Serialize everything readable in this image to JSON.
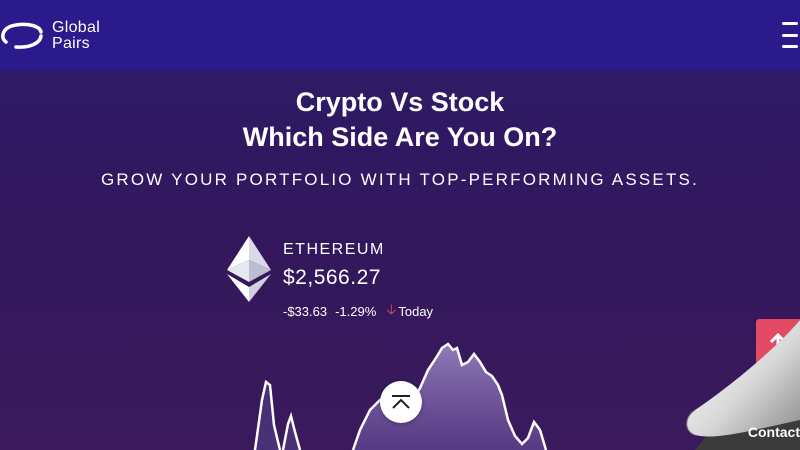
{
  "brand": {
    "line1": "Global",
    "line2": "Pairs",
    "logo_icon": "ring-logo-icon",
    "menu_icon": "hamburger-menu-icon"
  },
  "hero": {
    "headline_line1": "Crypto Vs Stock",
    "headline_line2": "Which Side Are You On?",
    "subheadline": "GROW YOUR PORTFOLIO WITH TOP-PERFORMING ASSETS."
  },
  "ticker": {
    "name": "ETHEREUM",
    "price": "$2,566.27",
    "change_abs": "-$33.63",
    "change_pct": "-1.29%",
    "direction_icon": "arrow-down-icon",
    "period": "Today",
    "coin_icon": "ethereum-icon"
  },
  "buttons": {
    "scroll_top_icon": "chevron-up-bar-icon",
    "back_to_top_icon": "arrow-up-icon",
    "contact_label": "Contact"
  },
  "colors": {
    "topbar": "#2a1a8c",
    "hero": "#33175c",
    "accent_red": "#e34a64",
    "down_red": "#e0505a"
  }
}
